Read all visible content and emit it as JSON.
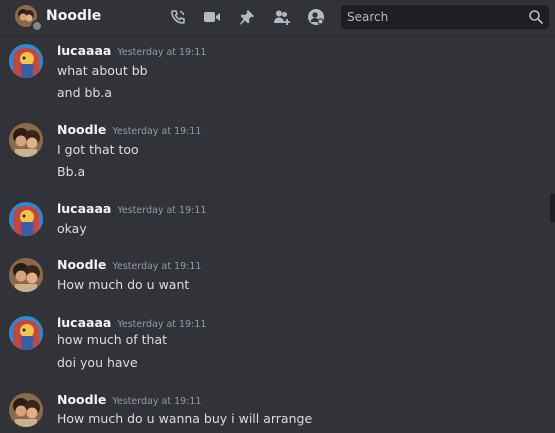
{
  "header": {
    "channel_name": "Noodle",
    "search_placeholder": "Search"
  },
  "messages": [
    {
      "author": "lucaaaa",
      "timestamp": "Yesterday at 19:11",
      "avatar": "lucaaaa-avatar",
      "lines": [
        "what about bb",
        "and bb.a"
      ]
    },
    {
      "author": "Noodle",
      "timestamp": "Yesterday at 19:11",
      "avatar": "noodle-avatar",
      "lines": [
        "I got that too",
        "Bb.a"
      ]
    },
    {
      "author": "lucaaaa",
      "timestamp": "Yesterday at 19:11",
      "avatar": "lucaaaa-avatar",
      "lines": [
        "okay"
      ]
    },
    {
      "author": "Noodle",
      "timestamp": "Yesterday at 19:11",
      "avatar": "noodle-avatar",
      "lines": [
        "How much do u want"
      ]
    },
    {
      "author": "lucaaaa",
      "timestamp": "Yesterday at 19:11",
      "avatar": "lucaaaa-avatar",
      "lines": [
        "how much of that",
        "doi you have"
      ]
    },
    {
      "author": "Noodle",
      "timestamp": "Yesterday at 19:11",
      "avatar": "noodle-avatar",
      "lines": [
        "How much do u wanna buy i will arrange"
      ]
    }
  ],
  "icons": [
    "phone-call-icon",
    "video-call-icon",
    "pin-icon",
    "add-friend-icon",
    "user-profile-icon",
    "search-icon"
  ],
  "colors": {
    "background": "#313338",
    "search_background": "#1e1f22",
    "text": "#dbdee1",
    "muted": "#949ba4"
  }
}
